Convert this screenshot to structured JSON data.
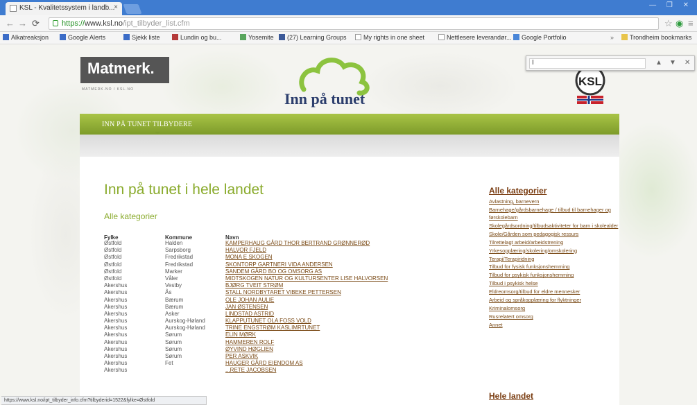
{
  "browser": {
    "tab_title": "KSL - Kvalitetssystem i landb...",
    "tab_close": "×",
    "url_scheme": "https://",
    "url_host": "www.ksl.no",
    "url_path": "/ipt_tilbyder_list.cfm",
    "window_controls": "— ❐ ✕",
    "bookmarks": [
      "Alkatreaksjon",
      "Google Alerts",
      "Sjekk liste",
      "Lundin og bu...",
      "Yosemite",
      "(27) Learning Groups",
      "My rights in one sheet",
      "Nettlesere leverandør...",
      "Google Portfolio",
      "Trondheim bookmarks"
    ],
    "find_value": "I",
    "status_text": "https://www.ksl.no/ipt_tilbyder_info.cfm?tilbyderid=1522&fylke=Østfold"
  },
  "header": {
    "brand_name": "Matmerk.",
    "brand_sub": "MATMERK.NO / KSL.NO",
    "site_title": "Inn på tunet",
    "ksl_label": "KSL",
    "nav_link": "INN PÅ TUNET TILBYDERE"
  },
  "main": {
    "heading": "Inn på tunet i hele landet",
    "subheading": "Alle kategorier",
    "columns": {
      "fylke": "Fylke",
      "kommune": "Kommune",
      "navn": "Navn"
    },
    "rows": [
      {
        "fylke": "Østfold",
        "kommune": "Halden",
        "navn": "KAMPERHAUG GÅRD THOR BERTRAND GRØNNERØD"
      },
      {
        "fylke": "Østfold",
        "kommune": "Sarpsborg",
        "navn": "HALVOR FJELD"
      },
      {
        "fylke": "Østfold",
        "kommune": "Fredrikstad",
        "navn": "MONA E SKOGEN"
      },
      {
        "fylke": "Østfold",
        "kommune": "Fredrikstad",
        "navn": "SKONTORP GARTNERI VIDA ANDERSEN"
      },
      {
        "fylke": "Østfold",
        "kommune": "Marker",
        "navn": "SANDEM GÅRD BO OG OMSORG AS"
      },
      {
        "fylke": "Østfold",
        "kommune": "Våler",
        "navn": "MIDTSKOGEN NATUR OG KULTURSENTER LISE HALVORSEN"
      },
      {
        "fylke": "Akershus",
        "kommune": "Vestby",
        "navn": "BJØRG TVEIT STRØM"
      },
      {
        "fylke": "Akershus",
        "kommune": "Ås",
        "navn": "STALL NORDBYTARET VIBEKE PETTERSEN"
      },
      {
        "fylke": "Akershus",
        "kommune": "Bærum",
        "navn": "OLE JOHAN AULIE"
      },
      {
        "fylke": "Akershus",
        "kommune": "Bærum",
        "navn": "JAN ØSTENSEN"
      },
      {
        "fylke": "Akershus",
        "kommune": "Asker",
        "navn": "LINDSTAD ASTRID"
      },
      {
        "fylke": "Akershus",
        "kommune": "Aurskog-Høland",
        "navn": "KLAPPUTUNET OLA FOSS VOLD"
      },
      {
        "fylke": "Akershus",
        "kommune": "Aurskog-Høland",
        "navn": "TRINE ENGSTRØM KASLIMRTUNET"
      },
      {
        "fylke": "Akershus",
        "kommune": "Sørum",
        "navn": "ELIN MØRK"
      },
      {
        "fylke": "Akershus",
        "kommune": "Sørum",
        "navn": "HAMMEREN ROLF"
      },
      {
        "fylke": "Akershus",
        "kommune": "Sørum",
        "navn": "ØYVIND HØGLIEN"
      },
      {
        "fylke": "Akershus",
        "kommune": "Sørum",
        "navn": "PER ASKVIK"
      },
      {
        "fylke": "Akershus",
        "kommune": "Fet",
        "navn": "HAUGER GÅRD EIENDOM AS"
      },
      {
        "fylke": "Akershus",
        "kommune": "",
        "navn": "...RETE JACOBSEN"
      }
    ]
  },
  "sidebar": {
    "title": "Alle kategorier",
    "items": [
      "Avlastning, barnevern",
      "Barnehage/gårdsbarnehage / tilbud til barnehager og førskolebarn",
      "Skolegårdsordning/tilbudsaktiviteter for barn i skolealder",
      "Skole/Gården som pedagogisk ressurs",
      "Tilrettelagt arbeid/arbeidstrening",
      "Yrkesopplæring/skolering/omskolering",
      "Terapi/Terapiridning",
      "Tilbud for fysisk funksjonshemming",
      "Tilbud for psykisk funksjonshemming",
      "Tilbud i psykisk helse",
      "Eldreomsorg/tilbud for eldre mennesker",
      "Arbeid og språkopplæring for flyktninger",
      "Kriminalomsorg",
      "Rusrelatert omsorg",
      "Annet"
    ],
    "title2": "Hele landet"
  }
}
